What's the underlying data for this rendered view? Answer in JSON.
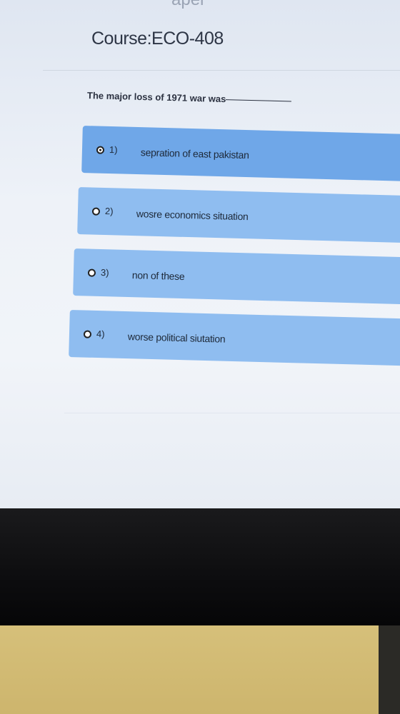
{
  "page": {
    "header_fragment": "aper",
    "course_title": "Course:ECO-408"
  },
  "question": {
    "text": "The major loss of 1971 war was",
    "selected_option": 1
  },
  "options": [
    {
      "number": "1)",
      "label": "sepration of east pakistan"
    },
    {
      "number": "2)",
      "label": "wosre economics situation"
    },
    {
      "number": "3)",
      "label": "non of these"
    },
    {
      "number": "4)",
      "label": "worse political siutation"
    }
  ],
  "colors": {
    "option_bg": "#8fbdf0",
    "option_selected_bg": "#6fa7e8",
    "page_bg": "#eef2f8"
  }
}
